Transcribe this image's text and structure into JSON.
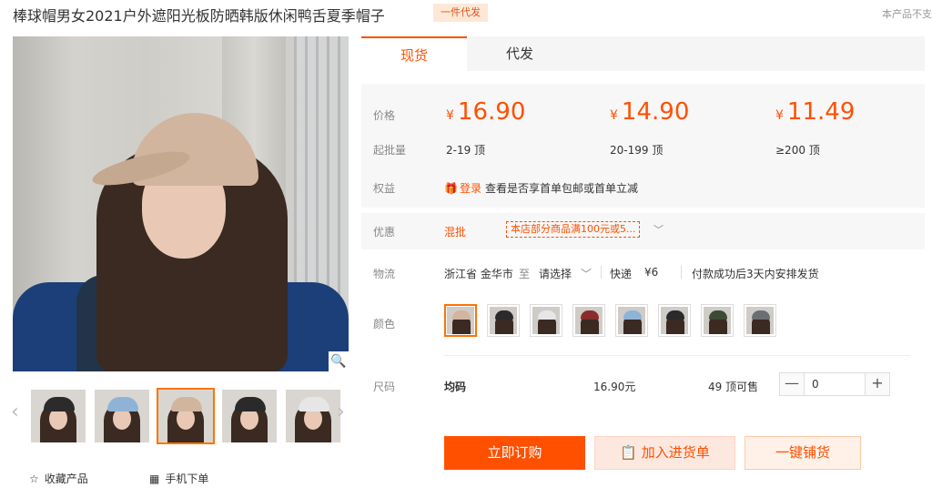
{
  "header": {
    "title": "棒球帽男女2021户外遮阳光板防晒韩版休闲鸭舌夏季帽子",
    "badge": "一件代发",
    "notice": "本产品不支"
  },
  "gallery": {
    "zoom_icon": "magnifier-icon",
    "thumbnails": [
      {
        "cap_color": "#2b2b2b"
      },
      {
        "cap_color": "#8fb3d6"
      },
      {
        "cap_color": "#d1b59f"
      },
      {
        "cap_color": "#2a2a2a"
      },
      {
        "cap_color": "#e6e6e6"
      }
    ],
    "favorite_label": "收藏产品",
    "mobile_label": "手机下单"
  },
  "tabs": [
    {
      "label": "现货"
    },
    {
      "label": "代发"
    }
  ],
  "pricing": {
    "price_label": "价格",
    "qty_label": "起批量",
    "currency": "¥",
    "tiers": [
      {
        "price": "16.90",
        "range": "2-19 顶"
      },
      {
        "price": "14.90",
        "range": "20-199 顶"
      },
      {
        "price": "11.49",
        "range": "≥200 顶"
      }
    ]
  },
  "benefit": {
    "label": "权益",
    "login": "登录",
    "text": "查看是否享首单包邮或首单立减"
  },
  "promo": {
    "label": "优惠",
    "mixed": "混批",
    "coupon": "本店部分商品满100元或5...",
    "expand": "﹀"
  },
  "shipping": {
    "label": "物流",
    "origin": "浙江省 金华市",
    "to": "至",
    "destination": "请选择",
    "method": "快递",
    "fee": "¥6",
    "note": "付款成功后3天内安排发货"
  },
  "color": {
    "label": "颜色",
    "options": [
      {
        "cap": "#d1b59f"
      },
      {
        "cap": "#2b2b2b"
      },
      {
        "cap": "#e6e6e6"
      },
      {
        "cap": "#8a2c2c"
      },
      {
        "cap": "#8fb3d6"
      },
      {
        "cap": "#2a2a2a"
      },
      {
        "cap": "#3c4a36"
      },
      {
        "cap": "#6b6f75"
      }
    ]
  },
  "size": {
    "label": "尺码",
    "value": "均码",
    "price": "16.90元",
    "stock": "49 顶可售",
    "quantity": "0",
    "minus": "—",
    "plus": "+"
  },
  "actions": {
    "buy": "立即订购",
    "cart": "加入进货单",
    "distribute": "一键铺货"
  },
  "colors": {
    "accent": "#ff5000",
    "accent_light": "#fde8e0"
  }
}
